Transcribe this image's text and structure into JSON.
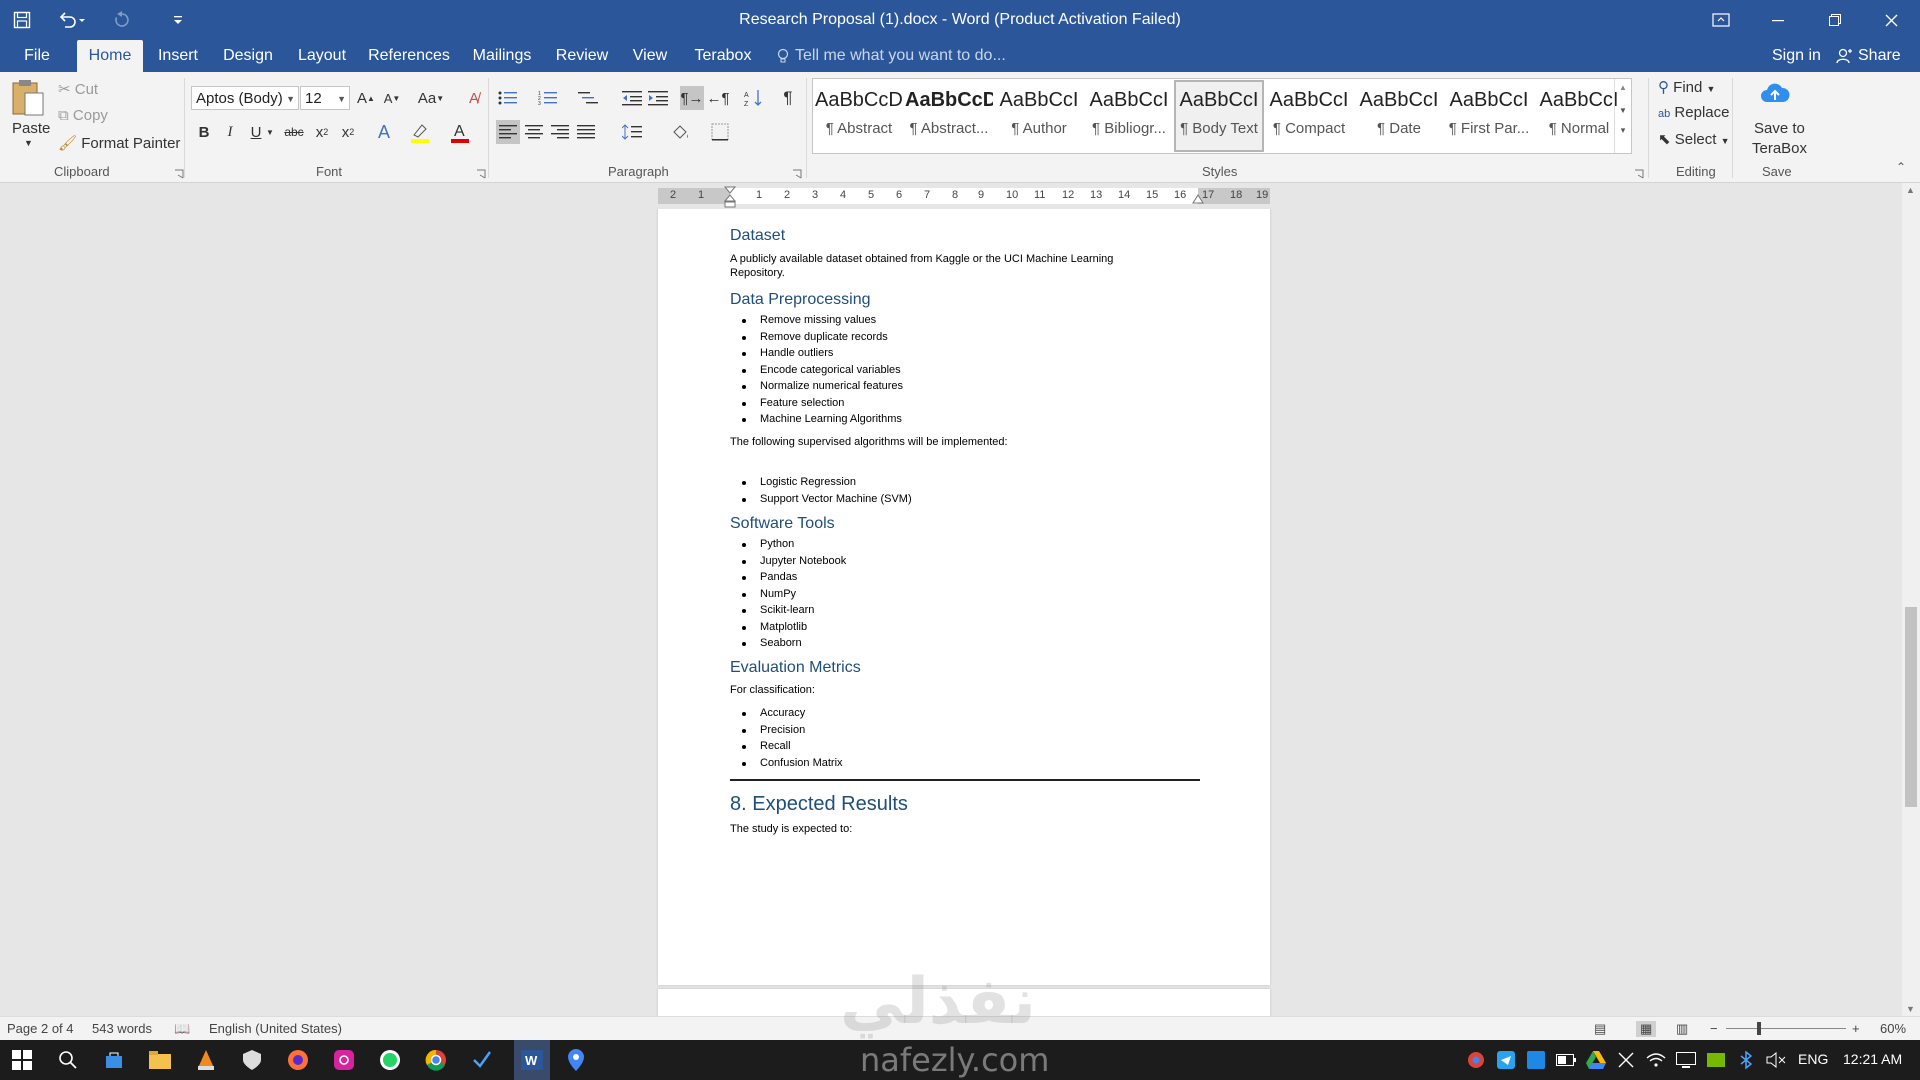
{
  "window": {
    "title": "Research Proposal (1).docx - Word (Product Activation Failed)",
    "accent": "#2b579a"
  },
  "tabs": {
    "file": "File",
    "home": "Home",
    "insert": "Insert",
    "design": "Design",
    "layout": "Layout",
    "references": "References",
    "mailings": "Mailings",
    "review": "Review",
    "view": "View",
    "terabox": "Terabox",
    "tell_me": "Tell me what you want to do...",
    "sign_in": "Sign in",
    "share": "Share"
  },
  "ribbon": {
    "clipboard": {
      "paste": "Paste",
      "cut": "Cut",
      "copy": "Copy",
      "format_painter": "Format Painter",
      "label": "Clipboard"
    },
    "font": {
      "name": "Aptos (Body)",
      "size": "12",
      "change_case": "Aa",
      "label": "Font"
    },
    "paragraph": {
      "label": "Paragraph"
    },
    "styles": {
      "label": "Styles",
      "items": [
        {
          "sample": "AaBbCcDd",
          "name": "¶ Abstract"
        },
        {
          "sample": "AaBbCcD",
          "name": "¶ Abstract..."
        },
        {
          "sample": "AaBbCcI",
          "name": "¶ Author"
        },
        {
          "sample": "AaBbCcI",
          "name": "¶ Bibliogr..."
        },
        {
          "sample": "AaBbCcI",
          "name": "¶ Body Text"
        },
        {
          "sample": "AaBbCcI",
          "name": "¶ Compact"
        },
        {
          "sample": "AaBbCcI",
          "name": "¶ Date"
        },
        {
          "sample": "AaBbCcI",
          "name": "¶ First Par..."
        },
        {
          "sample": "AaBbCcI",
          "name": "¶ Normal"
        }
      ]
    },
    "editing": {
      "find": "Find",
      "replace": "Replace",
      "select": "Select",
      "label": "Editing"
    },
    "save": {
      "save_to": "Save to",
      "terabox": "TeraBox",
      "label": "Save"
    }
  },
  "ruler": {
    "numbers": [
      "2",
      "1",
      "1",
      "1",
      "2",
      "3",
      "4",
      "5",
      "6",
      "7",
      "8",
      "9",
      "10",
      "11",
      "12",
      "13",
      "14",
      "15",
      "16",
      "17",
      "18",
      "19"
    ]
  },
  "document": {
    "dataset_heading": "Dataset",
    "dataset_text": "A publicly available dataset obtained from Kaggle or the UCI Machine Learning Repository.",
    "preprocessing_heading": "Data Preprocessing",
    "preprocessing_items": [
      "Remove missing values",
      "Remove duplicate records",
      "Handle outliers",
      "Encode categorical variables",
      "Normalize numerical features",
      "Feature selection",
      "Machine Learning Algorithms"
    ],
    "algorithms_intro": "The following supervised algorithms will be implemented:",
    "algorithms_items": [
      "Logistic Regression",
      "Support Vector Machine (SVM)"
    ],
    "software_heading": "Software Tools",
    "software_items": [
      "Python",
      "Jupyter Notebook",
      "Pandas",
      "NumPy",
      "Scikit-learn",
      "Matplotlib",
      "Seaborn"
    ],
    "evaluation_heading": "Evaluation Metrics",
    "evaluation_intro": "For classification:",
    "evaluation_items": [
      "Accuracy",
      "Precision",
      "Recall",
      "Confusion Matrix"
    ],
    "results_heading": "8. Expected Results",
    "results_text": "The study is expected to:"
  },
  "status": {
    "page": "Page 2 of 4",
    "words": "543 words",
    "language": "English (United States)",
    "zoom": "60%"
  },
  "taskbar": {
    "language": "ENG",
    "time": "12:21 AM"
  },
  "watermark": {
    "arabic": "نفذلي",
    "latin": "nafezly.com"
  }
}
